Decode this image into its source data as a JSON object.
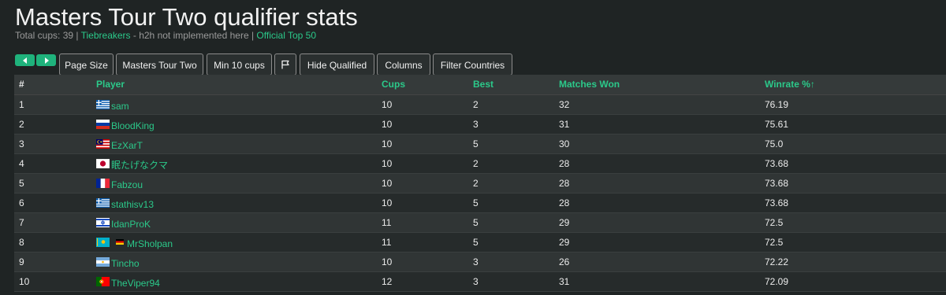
{
  "page": {
    "title": "Masters Tour Two qualifier stats",
    "subtitle": {
      "prefix": "Total cups: 39 | ",
      "tiebreakers_link": "Tiebreakers",
      "middle": " - h2h not implemented here | ",
      "top50_link": "Official Top 50"
    }
  },
  "toolbar": {
    "prev_icon": "arrow-left-icon",
    "next_icon": "arrow-right-icon",
    "page_size": "Page Size",
    "tour": "Masters Tour Two",
    "min_cups": "Min 10 cups",
    "flag_icon": "flag-icon",
    "hide_qualified": "Hide Qualified",
    "columns": "Columns",
    "filter_countries": "Filter Countries"
  },
  "table": {
    "headers": [
      "#",
      "Player",
      "Cups",
      "Best",
      "Matches Won",
      "Winrate %↑"
    ],
    "rows": [
      {
        "rank": "1",
        "flag": "greece",
        "name": "sam",
        "cups": "10",
        "best": "2",
        "won": "32",
        "winrate": "76.19"
      },
      {
        "rank": "2",
        "flag": "russia",
        "name": "BloodKing",
        "cups": "10",
        "best": "3",
        "won": "31",
        "winrate": "75.61"
      },
      {
        "rank": "3",
        "flag": "malaysia",
        "name": "EzXarT",
        "cups": "10",
        "best": "5",
        "won": "30",
        "winrate": "75.0"
      },
      {
        "rank": "4",
        "flag": "japan",
        "name": "眠たげなクマ",
        "cups": "10",
        "best": "2",
        "won": "28",
        "winrate": "73.68"
      },
      {
        "rank": "5",
        "flag": "france",
        "name": "Fabzou",
        "cups": "10",
        "best": "2",
        "won": "28",
        "winrate": "73.68"
      },
      {
        "rank": "6",
        "flag": "greece",
        "name": "stathisv13",
        "cups": "10",
        "best": "5",
        "won": "28",
        "winrate": "73.68"
      },
      {
        "rank": "7",
        "flag": "israel",
        "name": "IdanProK",
        "cups": "11",
        "best": "5",
        "won": "29",
        "winrate": "72.5"
      },
      {
        "rank": "8",
        "flag": "kazakhstan",
        "extra_flag": "germany",
        "name": "MrSholpan",
        "cups": "11",
        "best": "5",
        "won": "29",
        "winrate": "72.5"
      },
      {
        "rank": "9",
        "flag": "argentina",
        "name": "Tincho",
        "cups": "10",
        "best": "3",
        "won": "26",
        "winrate": "72.22"
      },
      {
        "rank": "10",
        "flag": "portugal",
        "name": "TheViper94",
        "cups": "12",
        "best": "3",
        "won": "31",
        "winrate": "72.09"
      }
    ]
  },
  "colors": {
    "accent": "#2bc98a",
    "button_green": "#1fb37c",
    "background": "#1f2424"
  }
}
